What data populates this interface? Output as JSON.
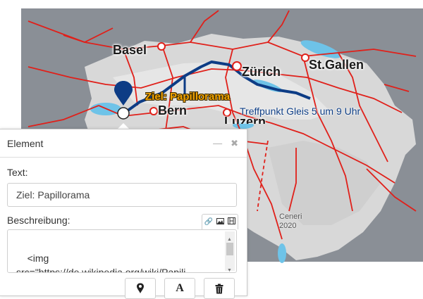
{
  "map": {
    "cities": {
      "basel": "Basel",
      "zurich": "Zürich",
      "stgallen": "St.Gallen",
      "bern": "Bern",
      "luzern": "Luzern"
    },
    "target_label": "Ziel: Papillorama",
    "meeting_label": "Treffpunkt Gleis 5 um 9 Uhr",
    "tunnel_label_line1": "Ceneri",
    "tunnel_label_line2": "2020",
    "colors": {
      "route": "#0d3c85",
      "rail": "#e0201a",
      "marker": "#0d3c85",
      "lake": "#6ec3e8"
    }
  },
  "panel": {
    "title": "Element",
    "minimize_icon": "minimize-icon",
    "close_icon": "close-icon",
    "text_label": "Text:",
    "text_value": "Ziel: Papillorama",
    "description_label": "Beschreibung:",
    "description_value": "<img\nsrc=\"https://de.wikipedia.org/wiki/Papili\nons...",
    "toolbar_icons": [
      "link-icon",
      "image-icon",
      "film-icon"
    ],
    "buttons": [
      {
        "name": "marker-button",
        "icon": "map-pin-icon"
      },
      {
        "name": "font-button",
        "icon": "font-icon",
        "glyph": "A"
      },
      {
        "name": "delete-button",
        "icon": "trash-icon"
      }
    ]
  }
}
